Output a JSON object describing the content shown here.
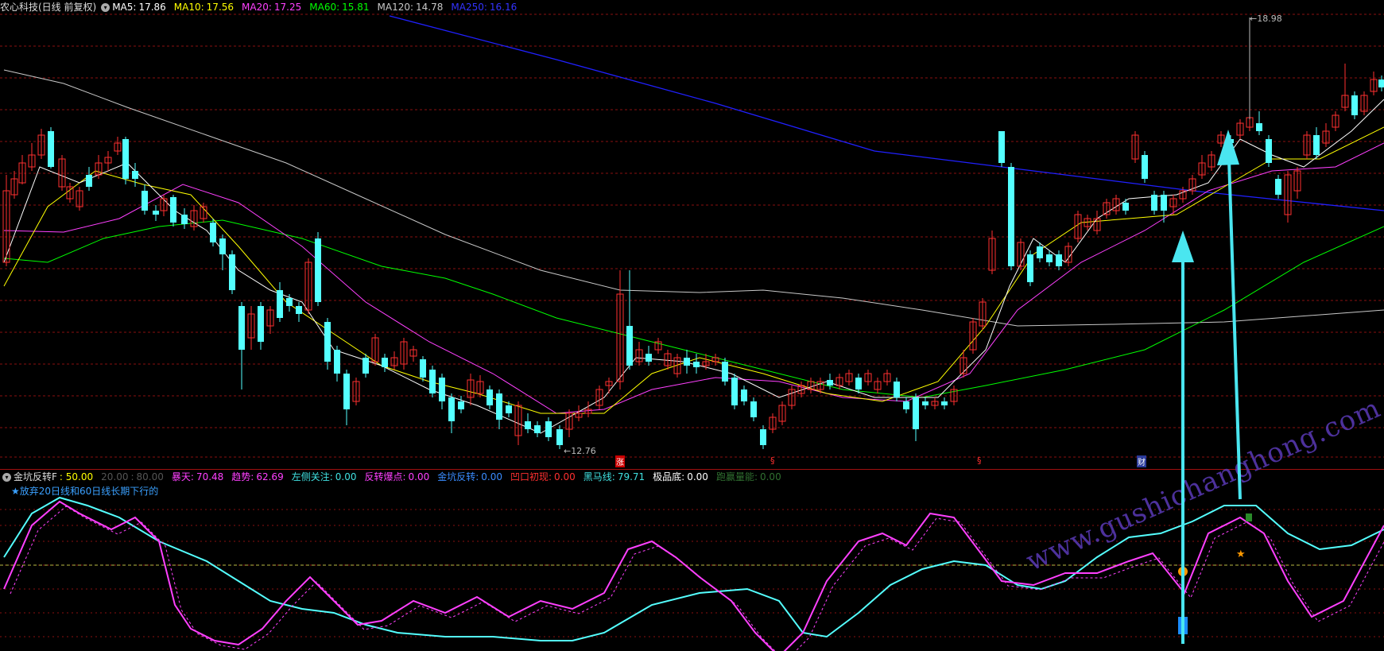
{
  "main_legend": {
    "title": "农心科技(日线 前复权)",
    "ma5_label": "MA5:",
    "ma5": "17.86",
    "ma10_label": "MA10:",
    "ma10": "17.56",
    "ma20_label": "MA20:",
    "ma20": "17.25",
    "ma60_label": "MA60:",
    "ma60": "15.81",
    "ma120_label": "MA120:",
    "ma120": "14.78",
    "ma250_label": "MA250:",
    "ma250": "16.16"
  },
  "price_labels": {
    "high": "18.98",
    "low": "12.76"
  },
  "event_markers": [
    "涨",
    "§",
    "§",
    "财"
  ],
  "indicator_legend": {
    "name": "金坑反转F",
    "param_main": ": 50.00",
    "param_sub1": "20.00",
    "param_sub2": "80.00",
    "items": [
      {
        "label": "暴天:",
        "value": "70.48",
        "color": "#ff40ff"
      },
      {
        "label": "趋势:",
        "value": "62.69",
        "color": "#ff40ff"
      },
      {
        "label": "左侧关注:",
        "value": "0.00",
        "color": "#40e0e0"
      },
      {
        "label": "反转爆点:",
        "value": "0.00",
        "color": "#ff40ff"
      },
      {
        "label": "金坑反转:",
        "value": "0.00",
        "color": "#3a8cff"
      },
      {
        "label": "凹口初现:",
        "value": "0.00",
        "color": "#ff3030"
      },
      {
        "label": "黑马线:",
        "value": "79.71",
        "color": "#40e0e0"
      },
      {
        "label": "极品底:",
        "value": "0.00",
        "color": "#ffffff"
      },
      {
        "label": "跑赢量能:",
        "value": "0.00",
        "color": "#307030"
      }
    ]
  },
  "indicator_note": "★放弃20日线和60日线长期下行的",
  "watermark": "www.gushichanghong.com",
  "colors": {
    "up": "#ff3030",
    "down": "#54ffff",
    "ma5": "#ffffff",
    "ma10": "#ffff00",
    "ma20": "#ff40ff",
    "ma60": "#00ff00",
    "ma120": "#c8c8c8",
    "ma250": "#2020ff",
    "arrow": "#4ae6f0",
    "grid": "#8a0f0f"
  }
}
